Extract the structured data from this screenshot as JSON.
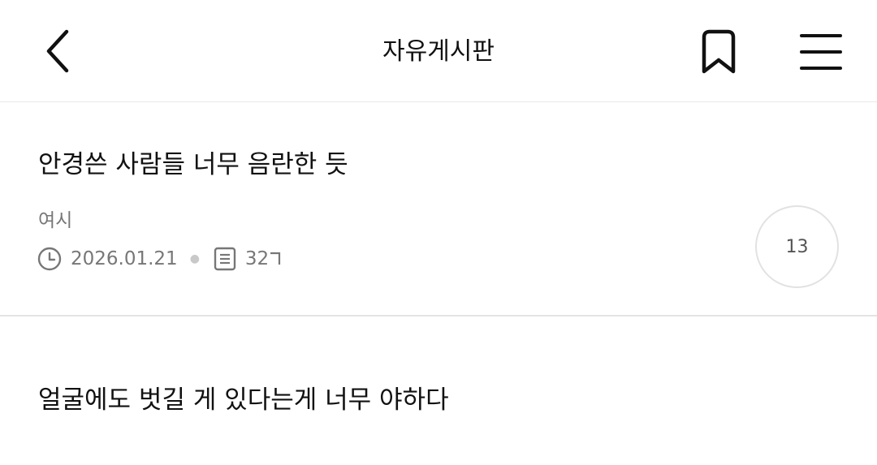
{
  "header": {
    "title": "자유게시판"
  },
  "posts": [
    {
      "title": "안경쓴 사람들 너무 음란한 듯",
      "author": "여시",
      "date": "2026.01.21",
      "views": "32",
      "comments": "13"
    },
    {
      "title": "얼굴에도 벗길 게 있다는게 너무 야하다"
    }
  ],
  "icons": {
    "back": "chevron-left-icon",
    "bookmark": "bookmark-icon",
    "menu": "hamburger-menu-icon",
    "clock": "clock-icon",
    "views": "document-icon"
  },
  "colors": {
    "text_primary": "#111111",
    "text_secondary": "#777777",
    "divider": "#e3e3e3"
  }
}
